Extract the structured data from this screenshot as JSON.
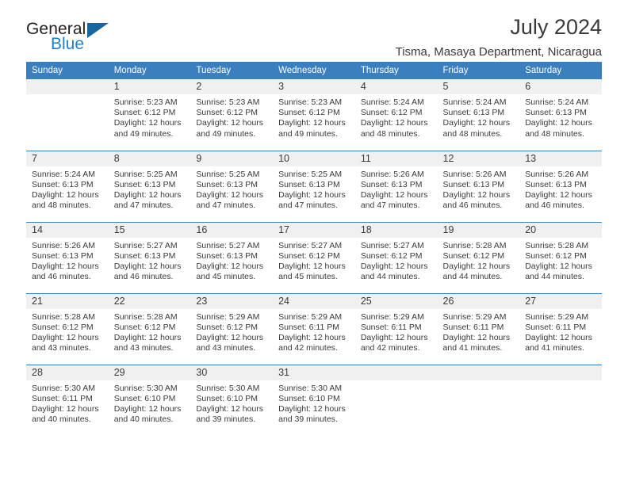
{
  "brand": {
    "name_part1": "General",
    "name_part2": "Blue",
    "triangle_color": "#17679e",
    "blue_color": "#2080d0"
  },
  "header": {
    "title": "July 2024",
    "subtitle": "Tisma, Masaya Department, Nicaragua"
  },
  "theme": {
    "header_row_bg": "#3c7fbe",
    "daynum_bg": "#f0f0f0",
    "text_color": "#3a3a3a"
  },
  "calendar": {
    "day_headers": [
      "Sunday",
      "Monday",
      "Tuesday",
      "Wednesday",
      "Thursday",
      "Friday",
      "Saturday"
    ],
    "weeks": [
      [
        {
          "day": "",
          "sunrise": "",
          "sunset": "",
          "daylight_line1": "",
          "daylight_line2": "",
          "empty": true
        },
        {
          "day": "1",
          "sunrise": "Sunrise: 5:23 AM",
          "sunset": "Sunset: 6:12 PM",
          "daylight_line1": "Daylight: 12 hours",
          "daylight_line2": "and 49 minutes."
        },
        {
          "day": "2",
          "sunrise": "Sunrise: 5:23 AM",
          "sunset": "Sunset: 6:12 PM",
          "daylight_line1": "Daylight: 12 hours",
          "daylight_line2": "and 49 minutes."
        },
        {
          "day": "3",
          "sunrise": "Sunrise: 5:23 AM",
          "sunset": "Sunset: 6:12 PM",
          "daylight_line1": "Daylight: 12 hours",
          "daylight_line2": "and 49 minutes."
        },
        {
          "day": "4",
          "sunrise": "Sunrise: 5:24 AM",
          "sunset": "Sunset: 6:12 PM",
          "daylight_line1": "Daylight: 12 hours",
          "daylight_line2": "and 48 minutes."
        },
        {
          "day": "5",
          "sunrise": "Sunrise: 5:24 AM",
          "sunset": "Sunset: 6:13 PM",
          "daylight_line1": "Daylight: 12 hours",
          "daylight_line2": "and 48 minutes."
        },
        {
          "day": "6",
          "sunrise": "Sunrise: 5:24 AM",
          "sunset": "Sunset: 6:13 PM",
          "daylight_line1": "Daylight: 12 hours",
          "daylight_line2": "and 48 minutes."
        }
      ],
      [
        {
          "day": "7",
          "sunrise": "Sunrise: 5:24 AM",
          "sunset": "Sunset: 6:13 PM",
          "daylight_line1": "Daylight: 12 hours",
          "daylight_line2": "and 48 minutes."
        },
        {
          "day": "8",
          "sunrise": "Sunrise: 5:25 AM",
          "sunset": "Sunset: 6:13 PM",
          "daylight_line1": "Daylight: 12 hours",
          "daylight_line2": "and 47 minutes."
        },
        {
          "day": "9",
          "sunrise": "Sunrise: 5:25 AM",
          "sunset": "Sunset: 6:13 PM",
          "daylight_line1": "Daylight: 12 hours",
          "daylight_line2": "and 47 minutes."
        },
        {
          "day": "10",
          "sunrise": "Sunrise: 5:25 AM",
          "sunset": "Sunset: 6:13 PM",
          "daylight_line1": "Daylight: 12 hours",
          "daylight_line2": "and 47 minutes."
        },
        {
          "day": "11",
          "sunrise": "Sunrise: 5:26 AM",
          "sunset": "Sunset: 6:13 PM",
          "daylight_line1": "Daylight: 12 hours",
          "daylight_line2": "and 47 minutes."
        },
        {
          "day": "12",
          "sunrise": "Sunrise: 5:26 AM",
          "sunset": "Sunset: 6:13 PM",
          "daylight_line1": "Daylight: 12 hours",
          "daylight_line2": "and 46 minutes."
        },
        {
          "day": "13",
          "sunrise": "Sunrise: 5:26 AM",
          "sunset": "Sunset: 6:13 PM",
          "daylight_line1": "Daylight: 12 hours",
          "daylight_line2": "and 46 minutes."
        }
      ],
      [
        {
          "day": "14",
          "sunrise": "Sunrise: 5:26 AM",
          "sunset": "Sunset: 6:13 PM",
          "daylight_line1": "Daylight: 12 hours",
          "daylight_line2": "and 46 minutes."
        },
        {
          "day": "15",
          "sunrise": "Sunrise: 5:27 AM",
          "sunset": "Sunset: 6:13 PM",
          "daylight_line1": "Daylight: 12 hours",
          "daylight_line2": "and 46 minutes."
        },
        {
          "day": "16",
          "sunrise": "Sunrise: 5:27 AM",
          "sunset": "Sunset: 6:13 PM",
          "daylight_line1": "Daylight: 12 hours",
          "daylight_line2": "and 45 minutes."
        },
        {
          "day": "17",
          "sunrise": "Sunrise: 5:27 AM",
          "sunset": "Sunset: 6:12 PM",
          "daylight_line1": "Daylight: 12 hours",
          "daylight_line2": "and 45 minutes."
        },
        {
          "day": "18",
          "sunrise": "Sunrise: 5:27 AM",
          "sunset": "Sunset: 6:12 PM",
          "daylight_line1": "Daylight: 12 hours",
          "daylight_line2": "and 44 minutes."
        },
        {
          "day": "19",
          "sunrise": "Sunrise: 5:28 AM",
          "sunset": "Sunset: 6:12 PM",
          "daylight_line1": "Daylight: 12 hours",
          "daylight_line2": "and 44 minutes."
        },
        {
          "day": "20",
          "sunrise": "Sunrise: 5:28 AM",
          "sunset": "Sunset: 6:12 PM",
          "daylight_line1": "Daylight: 12 hours",
          "daylight_line2": "and 44 minutes."
        }
      ],
      [
        {
          "day": "21",
          "sunrise": "Sunrise: 5:28 AM",
          "sunset": "Sunset: 6:12 PM",
          "daylight_line1": "Daylight: 12 hours",
          "daylight_line2": "and 43 minutes."
        },
        {
          "day": "22",
          "sunrise": "Sunrise: 5:28 AM",
          "sunset": "Sunset: 6:12 PM",
          "daylight_line1": "Daylight: 12 hours",
          "daylight_line2": "and 43 minutes."
        },
        {
          "day": "23",
          "sunrise": "Sunrise: 5:29 AM",
          "sunset": "Sunset: 6:12 PM",
          "daylight_line1": "Daylight: 12 hours",
          "daylight_line2": "and 43 minutes."
        },
        {
          "day": "24",
          "sunrise": "Sunrise: 5:29 AM",
          "sunset": "Sunset: 6:11 PM",
          "daylight_line1": "Daylight: 12 hours",
          "daylight_line2": "and 42 minutes."
        },
        {
          "day": "25",
          "sunrise": "Sunrise: 5:29 AM",
          "sunset": "Sunset: 6:11 PM",
          "daylight_line1": "Daylight: 12 hours",
          "daylight_line2": "and 42 minutes."
        },
        {
          "day": "26",
          "sunrise": "Sunrise: 5:29 AM",
          "sunset": "Sunset: 6:11 PM",
          "daylight_line1": "Daylight: 12 hours",
          "daylight_line2": "and 41 minutes."
        },
        {
          "day": "27",
          "sunrise": "Sunrise: 5:29 AM",
          "sunset": "Sunset: 6:11 PM",
          "daylight_line1": "Daylight: 12 hours",
          "daylight_line2": "and 41 minutes."
        }
      ],
      [
        {
          "day": "28",
          "sunrise": "Sunrise: 5:30 AM",
          "sunset": "Sunset: 6:11 PM",
          "daylight_line1": "Daylight: 12 hours",
          "daylight_line2": "and 40 minutes."
        },
        {
          "day": "29",
          "sunrise": "Sunrise: 5:30 AM",
          "sunset": "Sunset: 6:10 PM",
          "daylight_line1": "Daylight: 12 hours",
          "daylight_line2": "and 40 minutes."
        },
        {
          "day": "30",
          "sunrise": "Sunrise: 5:30 AM",
          "sunset": "Sunset: 6:10 PM",
          "daylight_line1": "Daylight: 12 hours",
          "daylight_line2": "and 39 minutes."
        },
        {
          "day": "31",
          "sunrise": "Sunrise: 5:30 AM",
          "sunset": "Sunset: 6:10 PM",
          "daylight_line1": "Daylight: 12 hours",
          "daylight_line2": "and 39 minutes."
        },
        {
          "day": "",
          "sunrise": "",
          "sunset": "",
          "daylight_line1": "",
          "daylight_line2": "",
          "empty": true
        },
        {
          "day": "",
          "sunrise": "",
          "sunset": "",
          "daylight_line1": "",
          "daylight_line2": "",
          "empty": true
        },
        {
          "day": "",
          "sunrise": "",
          "sunset": "",
          "daylight_line1": "",
          "daylight_line2": "",
          "empty": true
        }
      ]
    ]
  }
}
